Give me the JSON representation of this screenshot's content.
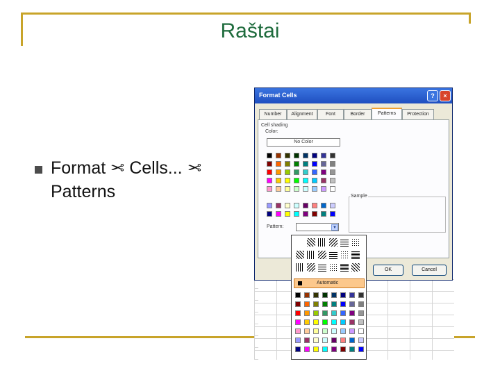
{
  "slide": {
    "title": "Raštai",
    "bullet": {
      "part1": "Format",
      "part2": "Cells...",
      "part3": "Patterns",
      "separator_icon": "scissors-icon"
    }
  },
  "dialog": {
    "title": "Format Cells",
    "help_glyph": "?",
    "close_glyph": "×",
    "tabs": [
      "Number",
      "Alignment",
      "Font",
      "Border",
      "Patterns",
      "Protection"
    ],
    "active_tab": "Patterns",
    "section_label": "Cell shading",
    "color_label": "Color:",
    "no_color_label": "No Color",
    "sample_label": "Sample",
    "pattern_label": "Pattern:",
    "pattern_arrow_glyph": "▼",
    "ok_label": "OK",
    "cancel_label": "Cancel",
    "palette_rows": [
      [
        "#000000",
        "#993300",
        "#333300",
        "#003300",
        "#003366",
        "#000080",
        "#333399",
        "#333333"
      ],
      [
        "#800000",
        "#ff6600",
        "#808000",
        "#008000",
        "#008080",
        "#0000ff",
        "#666699",
        "#808080"
      ],
      [
        "#ff0000",
        "#ff9900",
        "#99cc00",
        "#339966",
        "#33cccc",
        "#3366ff",
        "#800080",
        "#969696"
      ],
      [
        "#ff00ff",
        "#ffcc00",
        "#ffff00",
        "#00ff00",
        "#00ffff",
        "#00ccff",
        "#993366",
        "#c0c0c0"
      ],
      [
        "#ff99cc",
        "#ffcc99",
        "#ffff99",
        "#ccffcc",
        "#ccffff",
        "#99ccff",
        "#cc99ff",
        "#ffffff"
      ]
    ],
    "extra_rows": [
      [
        "#9999ff",
        "#993366",
        "#ffffcc",
        "#ccffff",
        "#660066",
        "#ff8080",
        "#0066cc",
        "#ccccff"
      ],
      [
        "#000080",
        "#ff00ff",
        "#ffff00",
        "#00ffff",
        "#800080",
        "#800000",
        "#008080",
        "#0000ff"
      ]
    ]
  },
  "pattern_dropdown": {
    "automatic_label": "Automatic",
    "palette_rows": [
      [
        "#000000",
        "#993300",
        "#333300",
        "#003300",
        "#003366",
        "#000080",
        "#333399",
        "#333333"
      ],
      [
        "#800000",
        "#ff6600",
        "#808000",
        "#008000",
        "#008080",
        "#0000ff",
        "#666699",
        "#808080"
      ],
      [
        "#ff0000",
        "#ff9900",
        "#99cc00",
        "#339966",
        "#33cccc",
        "#3366ff",
        "#800080",
        "#969696"
      ],
      [
        "#ff00ff",
        "#ffcc00",
        "#ffff00",
        "#00ff00",
        "#00ffff",
        "#00ccff",
        "#993366",
        "#c0c0c0"
      ],
      [
        "#ff99cc",
        "#ffcc99",
        "#ffff99",
        "#ccffcc",
        "#ccffff",
        "#99ccff",
        "#cc99ff",
        "#ffffff"
      ],
      [
        "#9999ff",
        "#993366",
        "#ffffcc",
        "#ccffff",
        "#660066",
        "#ff8080",
        "#0066cc",
        "#ccccff"
      ],
      [
        "#000080",
        "#ff00ff",
        "#ffff00",
        "#00ffff",
        "#800080",
        "#800000",
        "#008080",
        "#0000ff"
      ]
    ]
  }
}
